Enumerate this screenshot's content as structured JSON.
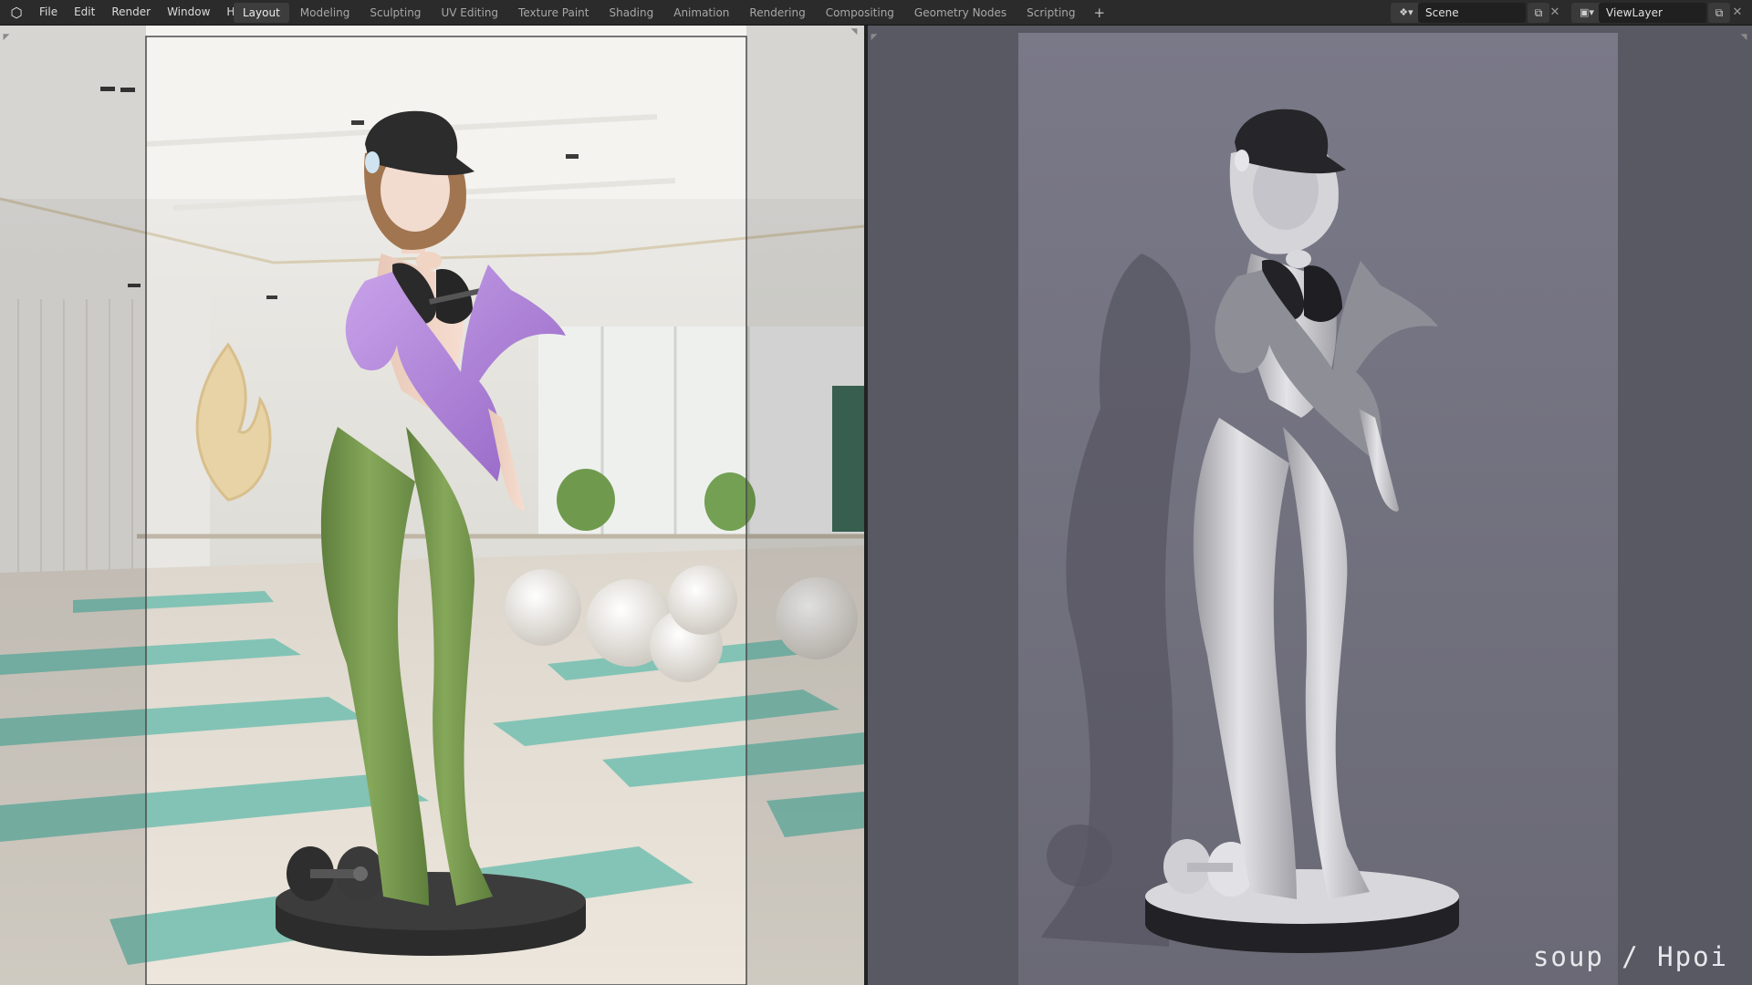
{
  "app": {
    "logo_icon": "blender-logo-icon"
  },
  "menu": [
    "File",
    "Edit",
    "Render",
    "Window",
    "Help"
  ],
  "workspaces": {
    "active": "Layout",
    "tabs": [
      "Layout",
      "Modeling",
      "Sculpting",
      "UV Editing",
      "Texture Paint",
      "Shading",
      "Animation",
      "Rendering",
      "Compositing",
      "Geometry Nodes",
      "Scripting"
    ],
    "add_icon": "plus-icon"
  },
  "scene": {
    "value": "Scene",
    "icon": "scene-icon"
  },
  "view_layer": {
    "value": "ViewLayer",
    "icon": "render-layers-icon"
  },
  "watermark": "soup / Hpoi",
  "colors": {
    "topbar": "#2b2b2b",
    "active_tab": "#3d3d3d",
    "jacket": "#b48ad8",
    "leggings": "#7d9e52",
    "mat": "#7ec2b4",
    "clay": "#c9c9cf",
    "backdrop": "#6a6a76"
  }
}
